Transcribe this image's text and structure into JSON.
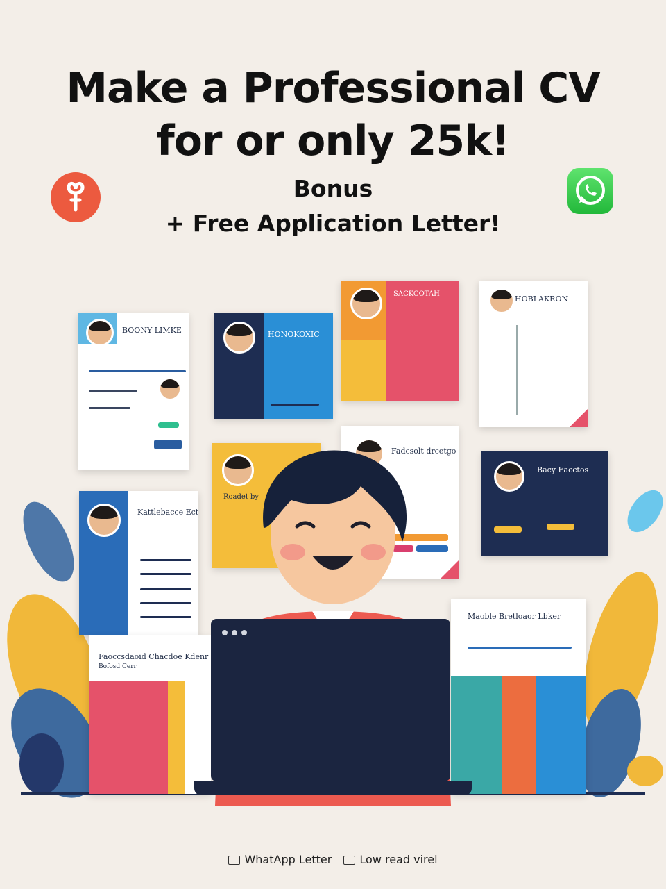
{
  "headline": {
    "line1": "Make a Professional CV",
    "line2": "for or only 25k!",
    "bonus": "Bonus",
    "free": "+ Free Application Letter!"
  },
  "colors": {
    "background": "#f3eee8",
    "navy": "#1e2d52",
    "blue": "#2a8fd6",
    "yellow": "#f4bd3a",
    "red": "#e5526a",
    "orange": "#ec5a3f",
    "whatsapp_green": "#2fcb4a"
  },
  "icons": [
    "app-logo-icon",
    "whatsapp-icon",
    "laptop-icon",
    "leaf-icon",
    "mail-icon"
  ],
  "cards": [
    {
      "title": "BOONY LIMKE"
    },
    {
      "title": "HONOKOXIC"
    },
    {
      "title": "SACKCOTAH"
    },
    {
      "title": "HOBLAKRON"
    },
    {
      "title": "Kattlebacce Ectluns"
    },
    {
      "title": "Roadet by"
    },
    {
      "title": "Fadcsolt drcetgo"
    },
    {
      "title": "Bacy Eacctos"
    },
    {
      "title": "Faoccsdaoid Chacdoe Kdenr",
      "subtitle": "Bofosd Cerr"
    },
    {
      "title": "Maoble Bretloaor Lbker"
    }
  ],
  "footer": {
    "item1": "WhatApp Letter",
    "item2": "Low read virel"
  }
}
